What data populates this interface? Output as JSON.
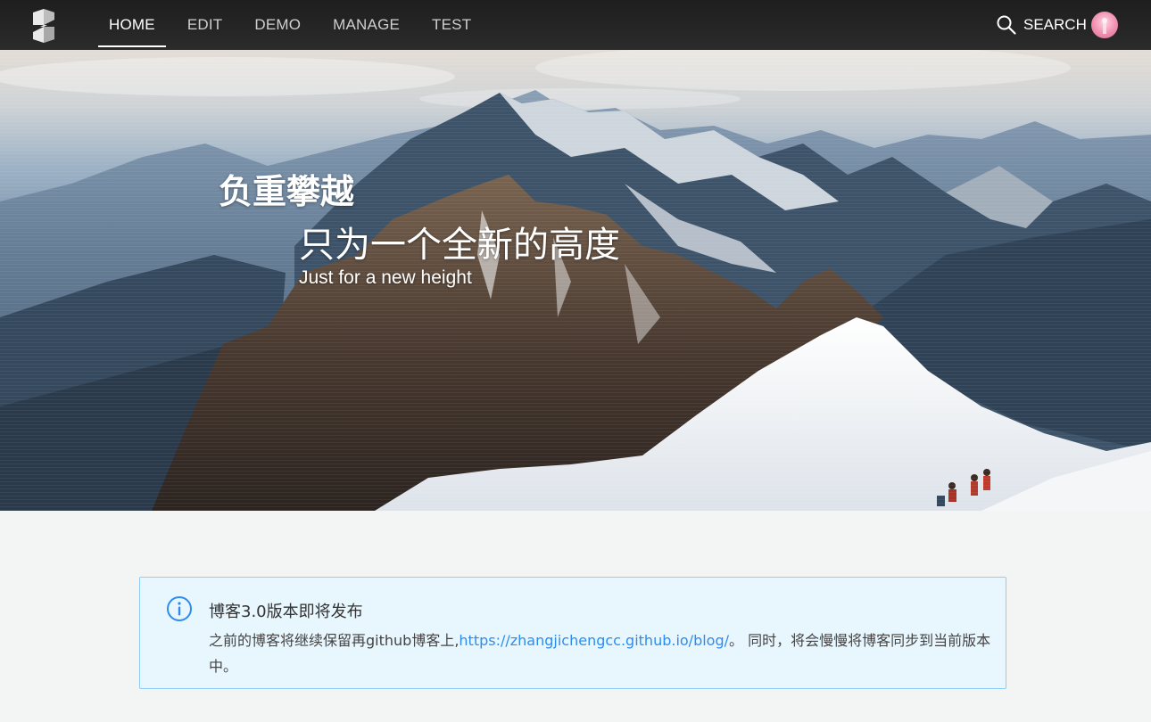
{
  "nav": {
    "logo": "logo-icon",
    "links": [
      {
        "label": "HOME",
        "active": true
      },
      {
        "label": "EDIT",
        "active": false
      },
      {
        "label": "DEMO",
        "active": false
      },
      {
        "label": "MANAGE",
        "active": false
      },
      {
        "label": "TEST",
        "active": false
      }
    ],
    "search_label": "SEARCH",
    "search_icon": "search-icon",
    "active_color": "#ffffff",
    "background": "#232323"
  },
  "hero": {
    "title": "负重攀越",
    "subtitle": "只为一个全新的高度",
    "tagline": "Just for a new height",
    "image": "mountain-climbers-photo"
  },
  "notice": {
    "icon": "info-icon",
    "title": "博客3.0版本即将发布",
    "body_before": "之前的博客将继续保留再github博客上,",
    "link": "https://zhangjichengcc.github.io/blog/",
    "body_after": "。 同时，将会慢慢将博客同步到当前版本中。",
    "accent": "#2d8cf0",
    "background": "#e8f6fe",
    "border": "#8ecdf5"
  }
}
